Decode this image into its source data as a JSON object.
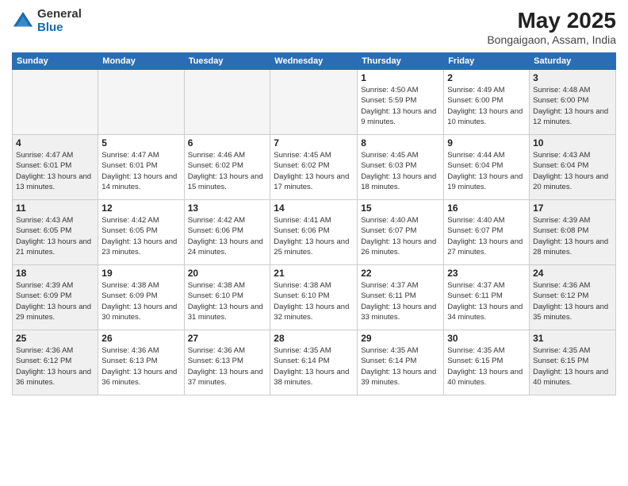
{
  "header": {
    "logo_general": "General",
    "logo_blue": "Blue",
    "month_year": "May 2025",
    "location": "Bongaigaon, Assam, India"
  },
  "days_of_week": [
    "Sunday",
    "Monday",
    "Tuesday",
    "Wednesday",
    "Thursday",
    "Friday",
    "Saturday"
  ],
  "weeks": [
    [
      {
        "day": "",
        "info": "",
        "empty": true
      },
      {
        "day": "",
        "info": "",
        "empty": true
      },
      {
        "day": "",
        "info": "",
        "empty": true
      },
      {
        "day": "",
        "info": "",
        "empty": true
      },
      {
        "day": "1",
        "info": "Sunrise: 4:50 AM\nSunset: 5:59 PM\nDaylight: 13 hours\nand 9 minutes."
      },
      {
        "day": "2",
        "info": "Sunrise: 4:49 AM\nSunset: 6:00 PM\nDaylight: 13 hours\nand 10 minutes."
      },
      {
        "day": "3",
        "info": "Sunrise: 4:48 AM\nSunset: 6:00 PM\nDaylight: 13 hours\nand 12 minutes."
      }
    ],
    [
      {
        "day": "4",
        "info": "Sunrise: 4:47 AM\nSunset: 6:01 PM\nDaylight: 13 hours\nand 13 minutes."
      },
      {
        "day": "5",
        "info": "Sunrise: 4:47 AM\nSunset: 6:01 PM\nDaylight: 13 hours\nand 14 minutes."
      },
      {
        "day": "6",
        "info": "Sunrise: 4:46 AM\nSunset: 6:02 PM\nDaylight: 13 hours\nand 15 minutes."
      },
      {
        "day": "7",
        "info": "Sunrise: 4:45 AM\nSunset: 6:02 PM\nDaylight: 13 hours\nand 17 minutes."
      },
      {
        "day": "8",
        "info": "Sunrise: 4:45 AM\nSunset: 6:03 PM\nDaylight: 13 hours\nand 18 minutes."
      },
      {
        "day": "9",
        "info": "Sunrise: 4:44 AM\nSunset: 6:04 PM\nDaylight: 13 hours\nand 19 minutes."
      },
      {
        "day": "10",
        "info": "Sunrise: 4:43 AM\nSunset: 6:04 PM\nDaylight: 13 hours\nand 20 minutes."
      }
    ],
    [
      {
        "day": "11",
        "info": "Sunrise: 4:43 AM\nSunset: 6:05 PM\nDaylight: 13 hours\nand 21 minutes."
      },
      {
        "day": "12",
        "info": "Sunrise: 4:42 AM\nSunset: 6:05 PM\nDaylight: 13 hours\nand 23 minutes."
      },
      {
        "day": "13",
        "info": "Sunrise: 4:42 AM\nSunset: 6:06 PM\nDaylight: 13 hours\nand 24 minutes."
      },
      {
        "day": "14",
        "info": "Sunrise: 4:41 AM\nSunset: 6:06 PM\nDaylight: 13 hours\nand 25 minutes."
      },
      {
        "day": "15",
        "info": "Sunrise: 4:40 AM\nSunset: 6:07 PM\nDaylight: 13 hours\nand 26 minutes."
      },
      {
        "day": "16",
        "info": "Sunrise: 4:40 AM\nSunset: 6:07 PM\nDaylight: 13 hours\nand 27 minutes."
      },
      {
        "day": "17",
        "info": "Sunrise: 4:39 AM\nSunset: 6:08 PM\nDaylight: 13 hours\nand 28 minutes."
      }
    ],
    [
      {
        "day": "18",
        "info": "Sunrise: 4:39 AM\nSunset: 6:09 PM\nDaylight: 13 hours\nand 29 minutes."
      },
      {
        "day": "19",
        "info": "Sunrise: 4:38 AM\nSunset: 6:09 PM\nDaylight: 13 hours\nand 30 minutes."
      },
      {
        "day": "20",
        "info": "Sunrise: 4:38 AM\nSunset: 6:10 PM\nDaylight: 13 hours\nand 31 minutes."
      },
      {
        "day": "21",
        "info": "Sunrise: 4:38 AM\nSunset: 6:10 PM\nDaylight: 13 hours\nand 32 minutes."
      },
      {
        "day": "22",
        "info": "Sunrise: 4:37 AM\nSunset: 6:11 PM\nDaylight: 13 hours\nand 33 minutes."
      },
      {
        "day": "23",
        "info": "Sunrise: 4:37 AM\nSunset: 6:11 PM\nDaylight: 13 hours\nand 34 minutes."
      },
      {
        "day": "24",
        "info": "Sunrise: 4:36 AM\nSunset: 6:12 PM\nDaylight: 13 hours\nand 35 minutes."
      }
    ],
    [
      {
        "day": "25",
        "info": "Sunrise: 4:36 AM\nSunset: 6:12 PM\nDaylight: 13 hours\nand 36 minutes."
      },
      {
        "day": "26",
        "info": "Sunrise: 4:36 AM\nSunset: 6:13 PM\nDaylight: 13 hours\nand 36 minutes."
      },
      {
        "day": "27",
        "info": "Sunrise: 4:36 AM\nSunset: 6:13 PM\nDaylight: 13 hours\nand 37 minutes."
      },
      {
        "day": "28",
        "info": "Sunrise: 4:35 AM\nSunset: 6:14 PM\nDaylight: 13 hours\nand 38 minutes."
      },
      {
        "day": "29",
        "info": "Sunrise: 4:35 AM\nSunset: 6:14 PM\nDaylight: 13 hours\nand 39 minutes."
      },
      {
        "day": "30",
        "info": "Sunrise: 4:35 AM\nSunset: 6:15 PM\nDaylight: 13 hours\nand 40 minutes."
      },
      {
        "day": "31",
        "info": "Sunrise: 4:35 AM\nSunset: 6:15 PM\nDaylight: 13 hours\nand 40 minutes."
      }
    ]
  ]
}
